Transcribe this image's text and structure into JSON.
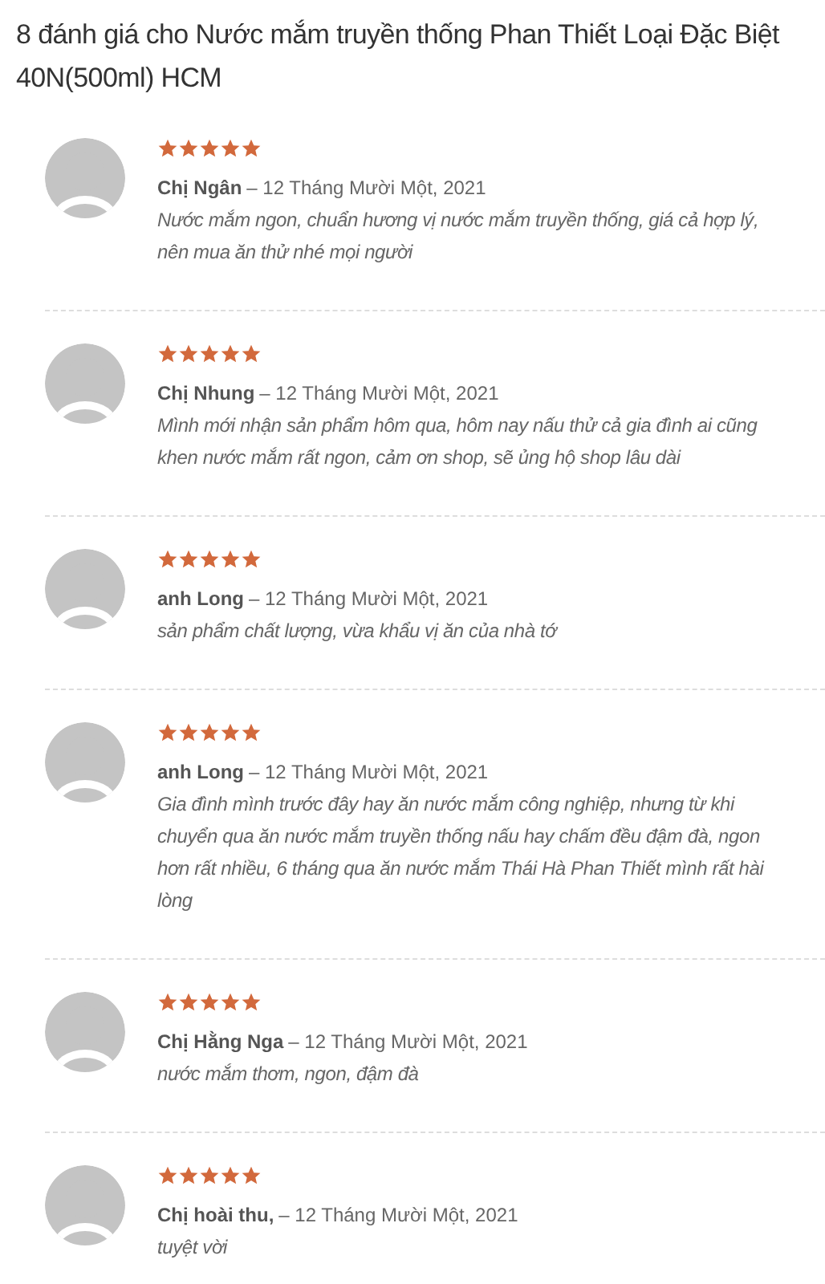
{
  "heading": "8 đánh giá cho Nước mắm truyền thống Phan Thiết Loại Đặc Biệt 40N(500ml) HCM",
  "reviews": [
    {
      "author": "Chị Ngân",
      "date": "– 12 Tháng Mười Một, 2021",
      "stars": 5,
      "text": "Nước mắm ngon, chuẩn hương vị nước mắm truyền thống, giá cả hợp lý, nên mua ăn thử nhé mọi người"
    },
    {
      "author": "Chị Nhung",
      "date": "– 12 Tháng Mười Một, 2021",
      "stars": 5,
      "text": "Mình mới nhận sản phẩm hôm qua, hôm nay nấu thử cả gia đình ai cũng khen nước mắm rất ngon, cảm ơn shop, sẽ ủng hộ shop lâu dài"
    },
    {
      "author": "anh Long",
      "date": "– 12 Tháng Mười Một, 2021",
      "stars": 5,
      "text": "sản phẩm chất lượng, vừa khẩu vị ăn của nhà tớ"
    },
    {
      "author": "anh Long",
      "date": "– 12 Tháng Mười Một, 2021",
      "stars": 5,
      "text": "Gia đình mình trước đây hay ăn nước mắm công nghiệp, nhưng từ khi chuyển qua ăn nước mắm truyền thống nấu hay chấm đều đậm đà, ngon hơn rất nhiều, 6 tháng qua ăn nước mắm Thái Hà Phan Thiết mình rất hài lòng"
    },
    {
      "author": "Chị Hằng Nga",
      "date": "– 12 Tháng Mười Một, 2021",
      "stars": 5,
      "text": "nước mắm thơm, ngon, đậm đà"
    },
    {
      "author": "Chị hoài thu,",
      "date": "– 12 Tháng Mười Một, 2021",
      "stars": 5,
      "text": "tuyệt vời"
    }
  ]
}
